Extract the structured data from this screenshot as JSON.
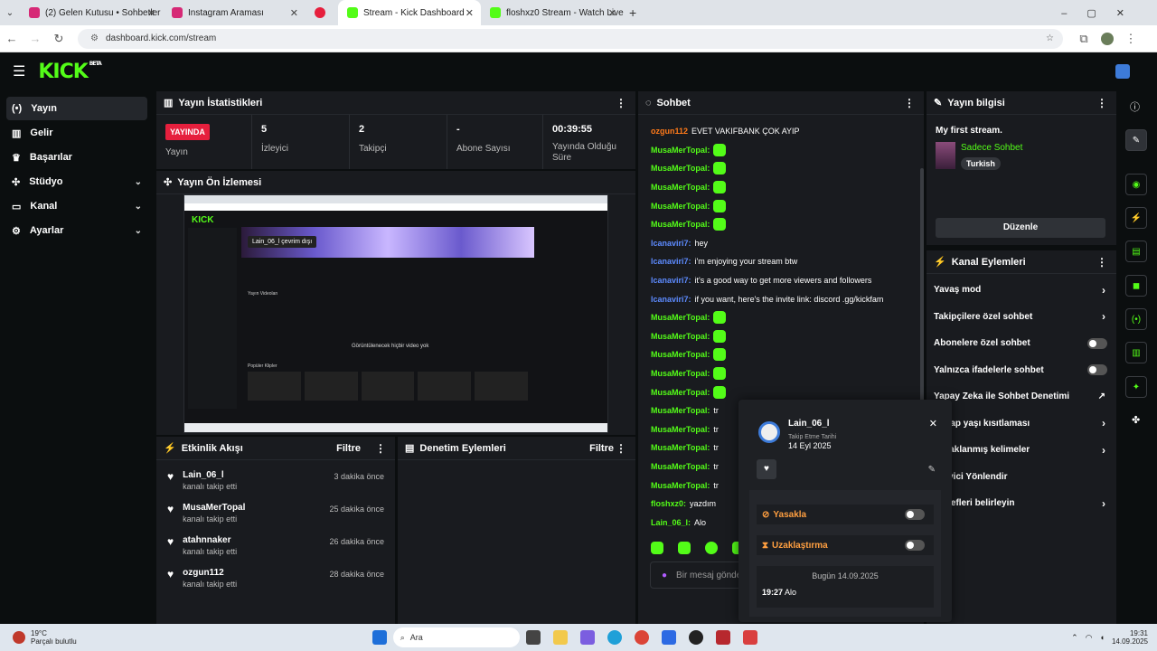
{
  "browser": {
    "tabs": [
      {
        "title": "(2) Gelen Kutusu • Sohbetler",
        "color": "#d62976"
      },
      {
        "title": "Instagram Araması",
        "color": "#d62976"
      },
      {
        "title": "",
        "color": "#e61f3d"
      },
      {
        "title": "Stream - Kick Dashboard",
        "color": "#53fc18"
      },
      {
        "title": "floshxz0 Stream - Watch Live o",
        "color": "#53fc18"
      }
    ],
    "url": "dashboard.kick.com/stream"
  },
  "kick": {
    "logo": "KICK",
    "beta": "BETA"
  },
  "sidebar": {
    "items": [
      {
        "label": "Yayın",
        "icon": "broadcast-icon"
      },
      {
        "label": "Gelir",
        "icon": "chart-icon"
      },
      {
        "label": "Başarılar",
        "icon": "trophy-icon"
      },
      {
        "label": "Stüdyo",
        "icon": "studio-icon"
      },
      {
        "label": "Kanal",
        "icon": "channel-icon"
      },
      {
        "label": "Ayarlar",
        "icon": "gear-icon"
      }
    ]
  },
  "stats": {
    "title": "Yayın İstatistikleri",
    "live_badge": "YAYINDA",
    "live_label": "Yayın",
    "viewers": "5",
    "viewers_label": "İzleyici",
    "followers": "2",
    "followers_label": "Takipçi",
    "subs": "-",
    "subs_label": "Abone Sayısı",
    "duration": "00:39:55",
    "duration_label": "Yayında Olduğu Süre"
  },
  "preview": {
    "title": "Yayın Ön İzlemesi",
    "channel_banner": "Lain_06_l çevrim dışı",
    "empty_text": "Görüntülenecek hiçbir video yok",
    "section": "Yayın Videoları",
    "clips": "Popüler Klipler"
  },
  "activity": {
    "title": "Etkinlik Akışı",
    "filter": "Filtre",
    "items": [
      {
        "name": "Lain_06_l",
        "action": "kanalı takip etti",
        "time": "3 dakika önce"
      },
      {
        "name": "MusaMerTopal",
        "action": "kanalı takip etti",
        "time": "25 dakika önce"
      },
      {
        "name": "atahnnaker",
        "action": "kanalı takip etti",
        "time": "26 dakika önce"
      },
      {
        "name": "ozgun112",
        "action": "kanalı takip etti",
        "time": "28 dakika önce"
      }
    ]
  },
  "moderation": {
    "title": "Denetim Eylemleri",
    "filter": "Filtre"
  },
  "chat": {
    "title": "Sohbet",
    "input_placeholder": "Bir mesaj gönder",
    "messages": [
      {
        "user": "ozgun112",
        "text": "EVET VAKIFBANK ÇOK AYIP",
        "color": "o"
      },
      {
        "user": "MusaMerTopal:",
        "text": "",
        "color": "g",
        "emote": true
      },
      {
        "user": "MusaMerTopal:",
        "text": "",
        "color": "g",
        "emote": true
      },
      {
        "user": "MusaMerTopal:",
        "text": "",
        "color": "g",
        "emote": true
      },
      {
        "user": "MusaMerTopal:",
        "text": "",
        "color": "g",
        "emote": true
      },
      {
        "user": "MusaMerTopal:",
        "text": "",
        "color": "g",
        "emote": true
      },
      {
        "user": "lcanaviri7:",
        "text": "hey",
        "color": "b"
      },
      {
        "user": "lcanaviri7:",
        "text": "i'm enjoying your stream btw",
        "color": "b"
      },
      {
        "user": "lcanaviri7:",
        "text": "it's a good way to get more viewers and followers",
        "color": "b"
      },
      {
        "user": "lcanaviri7:",
        "text": "if you want, here's the invite link: discord .gg/kickfam",
        "color": "b"
      },
      {
        "user": "MusaMerTopal:",
        "text": "",
        "color": "g",
        "emote": true
      },
      {
        "user": "MusaMerTopal:",
        "text": "",
        "color": "g",
        "emote": true
      },
      {
        "user": "MusaMerTopal:",
        "text": "",
        "color": "g",
        "emote": true
      },
      {
        "user": "MusaMerTopal:",
        "text": "",
        "color": "g",
        "emote": true
      },
      {
        "user": "MusaMerTopal:",
        "text": "",
        "color": "g",
        "emote": true
      },
      {
        "user": "MusaMerTopal:",
        "text": "tr",
        "color": "g"
      },
      {
        "user": "MusaMerTopal:",
        "text": "tr",
        "color": "g"
      },
      {
        "user": "MusaMerTopal:",
        "text": "tr",
        "color": "g"
      },
      {
        "user": "MusaMerTopal:",
        "text": "tr",
        "color": "g"
      },
      {
        "user": "MusaMerTopal:",
        "text": "tr",
        "color": "g"
      },
      {
        "user": "floshxz0:",
        "text": "yazdım",
        "color": "g"
      },
      {
        "user": "Lain_06_l:",
        "text": "Alo",
        "color": "g"
      }
    ]
  },
  "info": {
    "title": "Yayın bilgisi",
    "stream_title": "My first stream.",
    "category": "Sadece Sohbet",
    "tag": "Turkish",
    "edit": "Düzenle"
  },
  "channel_actions": {
    "title": "Kanal Eylemleri",
    "rows": [
      {
        "label": "Yavaş mod",
        "kind": "chev"
      },
      {
        "label": "Takipçilere özel sohbet",
        "kind": "chev"
      },
      {
        "label": "Abonelere özel sohbet",
        "kind": "toggle"
      },
      {
        "label": "Yalnızca ifadelerle sohbet",
        "kind": "toggle"
      },
      {
        "label": "Yapay Zeka ile Sohbet Denetimi",
        "kind": "ext"
      },
      {
        "label": "Hesap yaşı kısıtlaması",
        "kind": "chev"
      },
      {
        "label": "Yasaklanmış kelimeler",
        "kind": "chev"
      },
      {
        "label": "İzleyici Yönlendir",
        "kind": "none"
      },
      {
        "label": "Hedefleri belirleyin",
        "kind": "chev"
      }
    ]
  },
  "popup": {
    "username": "Lain_06_l",
    "follow_label": "Takip Etme Tarihi",
    "follow_date": "14 Eyl 2025",
    "ban": "Yasakla",
    "timeout": "Uzaklaştırma",
    "date_sep": "Bugün 14.09.2025",
    "msg_time": "19:27",
    "msg_text": "Alo"
  },
  "taskbar": {
    "weather_temp": "19°C",
    "weather_desc": "Parçalı bulutlu",
    "search": "Ara",
    "time": "19:31",
    "date": "14.09.2025"
  }
}
